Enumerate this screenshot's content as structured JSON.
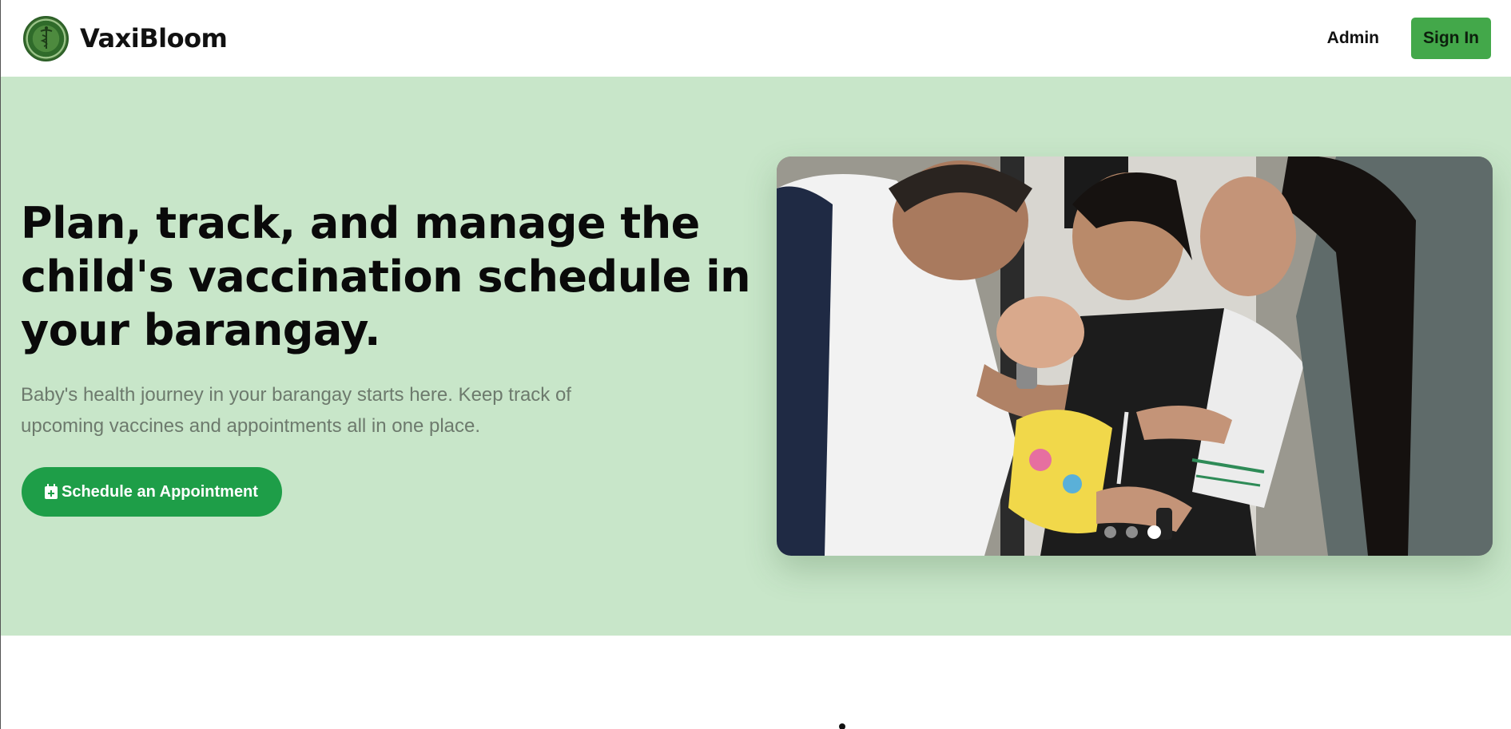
{
  "header": {
    "brand_name": "VaxiBloom",
    "logo_icon": "health-seal-logo",
    "nav_admin": "Admin",
    "sign_in_label": "Sign In"
  },
  "hero": {
    "headline": "Plan, track, and manage the child's vaccination schedule in your barangay.",
    "subtext": "Baby's health journey in your barangay starts here. Keep track of upcoming vaccines and appointments all in one place.",
    "cta_label": "Schedule an Appointment",
    "cta_icon": "calendar-plus-icon"
  },
  "carousel": {
    "slide_count": 3,
    "active_slide": 3
  },
  "colors": {
    "hero_background": "#c8e6c9",
    "accent_green": "#1e9e48",
    "sign_in_green": "#43a84a"
  }
}
